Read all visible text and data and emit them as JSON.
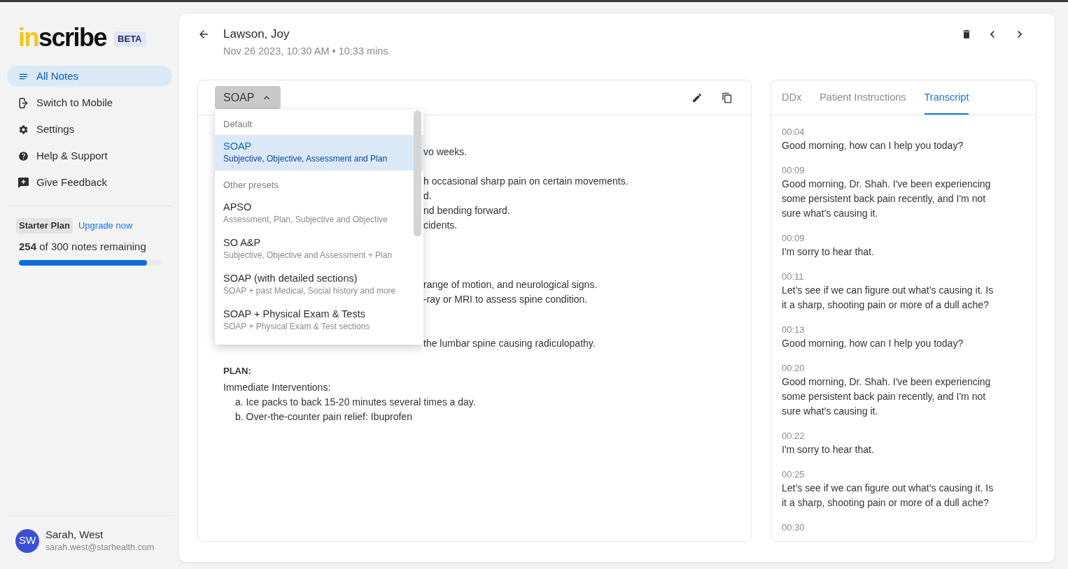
{
  "sidebar": {
    "logo": {
      "accent": "in",
      "rest": "scribe"
    },
    "badge": "BETA",
    "nav": [
      {
        "label": "All Notes",
        "selected": true
      },
      {
        "label": "Switch to Mobile",
        "selected": false
      },
      {
        "label": "Settings",
        "selected": false
      },
      {
        "label": "Help & Support",
        "selected": false
      },
      {
        "label": "Give Feedback",
        "selected": false
      }
    ],
    "plan": {
      "name": "Starter Plan",
      "upgrade_link": "Upgrade now",
      "usage": "**254** of 300 notes remaining",
      "level": 0.9
    },
    "user": {
      "initials": "SW",
      "name": "Sarah, West",
      "email": "sarah.west@starhealth.com"
    }
  },
  "header": {
    "patient": "Lawson, Joy",
    "details": "Nov 26 2023, 10:30 AM • 10:33 mins"
  },
  "note": {
    "format_button": {
      "label": "SOAP",
      "expanded": true
    },
    "preset_menu": {
      "sections": [
        {
          "heading": "Default",
          "items": [
            {
              "name": "SOAP",
              "description": "Subjective, Objective, Assessment and Plan",
              "selected": true
            }
          ]
        },
        {
          "heading": "Other presets",
          "items": [
            {
              "name": "APSO",
              "description": "Assessment, Plan, Subjective and Objective",
              "selected": false
            },
            {
              "name": "SO A&P",
              "description": "Subjective, Objective and Assessment + Plan",
              "selected": false
            },
            {
              "name": "SOAP (with detailed sections)",
              "description": "SOAP + past Medical, Social history and more",
              "selected": false
            },
            {
              "name": "SOAP + Physical Exam & Tests",
              "description": "SOAP + Physical Exam & Test sections",
              "selected": false
            }
          ]
        }
      ]
    },
    "fragment_groups": [
      [
        "vo weeks."
      ],
      [
        "h occasional sharp pain on certain movements.",
        "d.",
        "nd bending forward.",
        "cidents."
      ],
      [
        "range of motion, and neurological signs.",
        "-ray or MRI to assess spine condition."
      ],
      [
        "the lumbar spine causing radiculopathy."
      ]
    ],
    "plan": {
      "heading": "PLAN:",
      "subheading": "Immediate Interventions:",
      "items": [
        "a. Ice packs to back 15-20 minutes several times a day.",
        "b. Over-the-counter pain relief: Ibuprofen"
      ]
    }
  },
  "side_panel": {
    "tabs": [
      {
        "label": "DDx",
        "selected": false
      },
      {
        "label": "Patient Instructions",
        "selected": false
      },
      {
        "label": "Transcript",
        "selected": true
      }
    ],
    "transcript": [
      {
        "time": "00:04",
        "text": "Good morning, how can I help you today?"
      },
      {
        "time": "00:09",
        "text": "Good morning, Dr. Shah. I've been experiencing some persistent back pain recently, and I'm not sure what's causing it."
      },
      {
        "time": "00:09",
        "text": "I'm sorry to hear that."
      },
      {
        "time": "00:11",
        "text": "Let’s see if we can figure out what’s causing it. Is it a sharp, shooting pain or more of a dull ache?"
      },
      {
        "time": "00:13",
        "text": "Good morning, how can I help you today?"
      },
      {
        "time": "00:20",
        "text": "Good morning, Dr. Shah. I've been experiencing some persistent back pain recently, and I'm not sure what's causing it."
      },
      {
        "time": "00:22",
        "text": "I'm sorry to hear that."
      },
      {
        "time": "00:25",
        "text": "Let’s see if we can figure out what’s causing it. Is it a sharp, shooting pain or more of a dull ache?"
      },
      {
        "time": "00:30"
      }
    ]
  }
}
